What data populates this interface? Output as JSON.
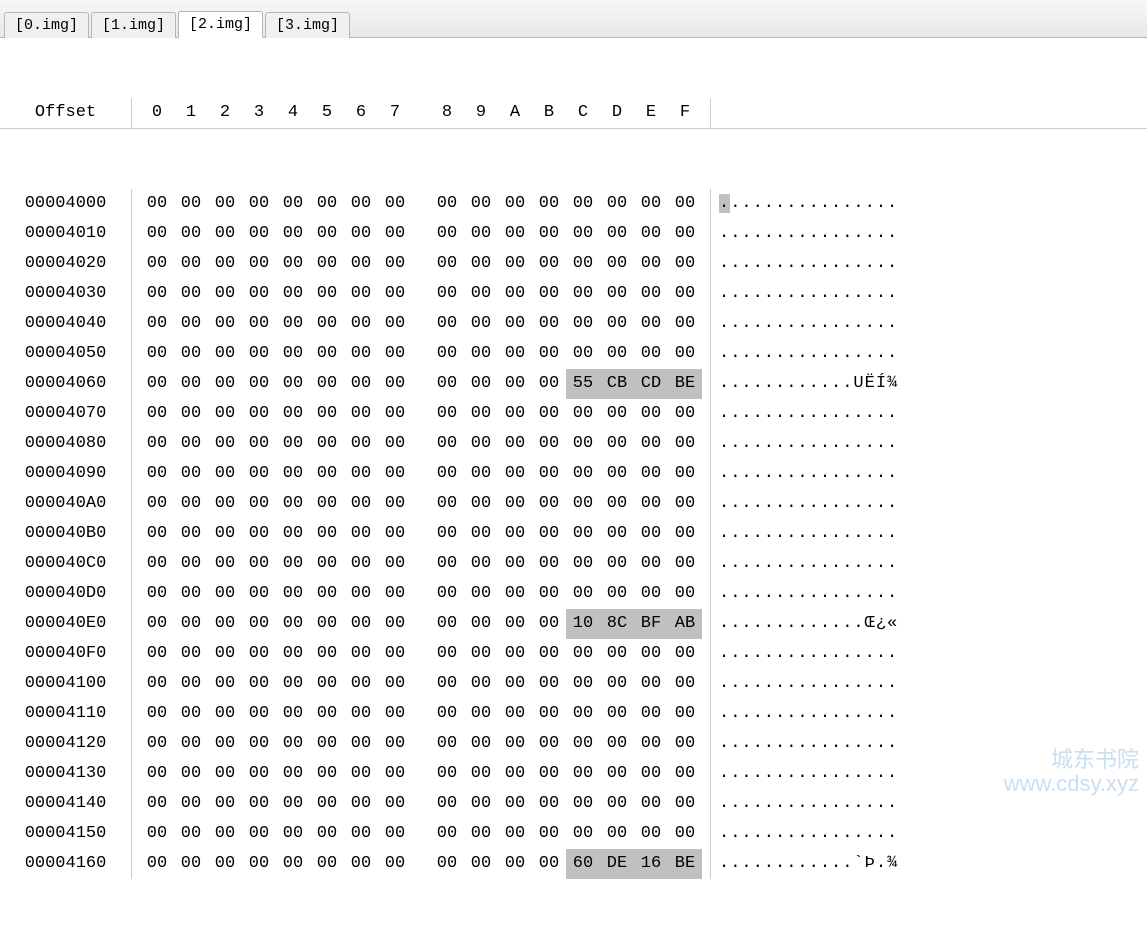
{
  "tabs": [
    {
      "label": "[0.img]",
      "active": false
    },
    {
      "label": "[1.img]",
      "active": false
    },
    {
      "label": "[2.img]",
      "active": true
    },
    {
      "label": "[3.img]",
      "active": false
    }
  ],
  "header": {
    "offset_label": "Offset",
    "columns": [
      "0",
      "1",
      "2",
      "3",
      "4",
      "5",
      "6",
      "7",
      "8",
      "9",
      "A",
      "B",
      "C",
      "D",
      "E",
      "F"
    ]
  },
  "rows": [
    {
      "offset": "00004000",
      "bytes": [
        "00",
        "00",
        "00",
        "00",
        "00",
        "00",
        "00",
        "00",
        "00",
        "00",
        "00",
        "00",
        "00",
        "00",
        "00",
        "00"
      ],
      "hl": [],
      "ascii": "................",
      "ascii_sel0": true
    },
    {
      "offset": "00004010",
      "bytes": [
        "00",
        "00",
        "00",
        "00",
        "00",
        "00",
        "00",
        "00",
        "00",
        "00",
        "00",
        "00",
        "00",
        "00",
        "00",
        "00"
      ],
      "hl": [],
      "ascii": "................"
    },
    {
      "offset": "00004020",
      "bytes": [
        "00",
        "00",
        "00",
        "00",
        "00",
        "00",
        "00",
        "00",
        "00",
        "00",
        "00",
        "00",
        "00",
        "00",
        "00",
        "00"
      ],
      "hl": [],
      "ascii": "................"
    },
    {
      "offset": "00004030",
      "bytes": [
        "00",
        "00",
        "00",
        "00",
        "00",
        "00",
        "00",
        "00",
        "00",
        "00",
        "00",
        "00",
        "00",
        "00",
        "00",
        "00"
      ],
      "hl": [],
      "ascii": "................"
    },
    {
      "offset": "00004040",
      "bytes": [
        "00",
        "00",
        "00",
        "00",
        "00",
        "00",
        "00",
        "00",
        "00",
        "00",
        "00",
        "00",
        "00",
        "00",
        "00",
        "00"
      ],
      "hl": [],
      "ascii": "................"
    },
    {
      "offset": "00004050",
      "bytes": [
        "00",
        "00",
        "00",
        "00",
        "00",
        "00",
        "00",
        "00",
        "00",
        "00",
        "00",
        "00",
        "00",
        "00",
        "00",
        "00"
      ],
      "hl": [],
      "ascii": "................"
    },
    {
      "offset": "00004060",
      "bytes": [
        "00",
        "00",
        "00",
        "00",
        "00",
        "00",
        "00",
        "00",
        "00",
        "00",
        "00",
        "00",
        "55",
        "CB",
        "CD",
        "BE"
      ],
      "hl": [
        12,
        13,
        14,
        15
      ],
      "ascii": "............UËÍ¾"
    },
    {
      "offset": "00004070",
      "bytes": [
        "00",
        "00",
        "00",
        "00",
        "00",
        "00",
        "00",
        "00",
        "00",
        "00",
        "00",
        "00",
        "00",
        "00",
        "00",
        "00"
      ],
      "hl": [],
      "ascii": "................"
    },
    {
      "offset": "00004080",
      "bytes": [
        "00",
        "00",
        "00",
        "00",
        "00",
        "00",
        "00",
        "00",
        "00",
        "00",
        "00",
        "00",
        "00",
        "00",
        "00",
        "00"
      ],
      "hl": [],
      "ascii": "................"
    },
    {
      "offset": "00004090",
      "bytes": [
        "00",
        "00",
        "00",
        "00",
        "00",
        "00",
        "00",
        "00",
        "00",
        "00",
        "00",
        "00",
        "00",
        "00",
        "00",
        "00"
      ],
      "hl": [],
      "ascii": "................"
    },
    {
      "offset": "000040A0",
      "bytes": [
        "00",
        "00",
        "00",
        "00",
        "00",
        "00",
        "00",
        "00",
        "00",
        "00",
        "00",
        "00",
        "00",
        "00",
        "00",
        "00"
      ],
      "hl": [],
      "ascii": "................"
    },
    {
      "offset": "000040B0",
      "bytes": [
        "00",
        "00",
        "00",
        "00",
        "00",
        "00",
        "00",
        "00",
        "00",
        "00",
        "00",
        "00",
        "00",
        "00",
        "00",
        "00"
      ],
      "hl": [],
      "ascii": "................"
    },
    {
      "offset": "000040C0",
      "bytes": [
        "00",
        "00",
        "00",
        "00",
        "00",
        "00",
        "00",
        "00",
        "00",
        "00",
        "00",
        "00",
        "00",
        "00",
        "00",
        "00"
      ],
      "hl": [],
      "ascii": "................"
    },
    {
      "offset": "000040D0",
      "bytes": [
        "00",
        "00",
        "00",
        "00",
        "00",
        "00",
        "00",
        "00",
        "00",
        "00",
        "00",
        "00",
        "00",
        "00",
        "00",
        "00"
      ],
      "hl": [],
      "ascii": "................"
    },
    {
      "offset": "000040E0",
      "bytes": [
        "00",
        "00",
        "00",
        "00",
        "00",
        "00",
        "00",
        "00",
        "00",
        "00",
        "00",
        "00",
        "10",
        "8C",
        "BF",
        "AB"
      ],
      "hl": [
        12,
        13,
        14,
        15
      ],
      "ascii": ".............Œ¿«"
    },
    {
      "offset": "000040F0",
      "bytes": [
        "00",
        "00",
        "00",
        "00",
        "00",
        "00",
        "00",
        "00",
        "00",
        "00",
        "00",
        "00",
        "00",
        "00",
        "00",
        "00"
      ],
      "hl": [],
      "ascii": "................"
    },
    {
      "offset": "00004100",
      "bytes": [
        "00",
        "00",
        "00",
        "00",
        "00",
        "00",
        "00",
        "00",
        "00",
        "00",
        "00",
        "00",
        "00",
        "00",
        "00",
        "00"
      ],
      "hl": [],
      "ascii": "................"
    },
    {
      "offset": "00004110",
      "bytes": [
        "00",
        "00",
        "00",
        "00",
        "00",
        "00",
        "00",
        "00",
        "00",
        "00",
        "00",
        "00",
        "00",
        "00",
        "00",
        "00"
      ],
      "hl": [],
      "ascii": "................"
    },
    {
      "offset": "00004120",
      "bytes": [
        "00",
        "00",
        "00",
        "00",
        "00",
        "00",
        "00",
        "00",
        "00",
        "00",
        "00",
        "00",
        "00",
        "00",
        "00",
        "00"
      ],
      "hl": [],
      "ascii": "................"
    },
    {
      "offset": "00004130",
      "bytes": [
        "00",
        "00",
        "00",
        "00",
        "00",
        "00",
        "00",
        "00",
        "00",
        "00",
        "00",
        "00",
        "00",
        "00",
        "00",
        "00"
      ],
      "hl": [],
      "ascii": "................"
    },
    {
      "offset": "00004140",
      "bytes": [
        "00",
        "00",
        "00",
        "00",
        "00",
        "00",
        "00",
        "00",
        "00",
        "00",
        "00",
        "00",
        "00",
        "00",
        "00",
        "00"
      ],
      "hl": [],
      "ascii": "................"
    },
    {
      "offset": "00004150",
      "bytes": [
        "00",
        "00",
        "00",
        "00",
        "00",
        "00",
        "00",
        "00",
        "00",
        "00",
        "00",
        "00",
        "00",
        "00",
        "00",
        "00"
      ],
      "hl": [],
      "ascii": "................"
    },
    {
      "offset": "00004160",
      "bytes": [
        "00",
        "00",
        "00",
        "00",
        "00",
        "00",
        "00",
        "00",
        "00",
        "00",
        "00",
        "00",
        "60",
        "DE",
        "16",
        "BE"
      ],
      "hl": [
        12,
        13,
        14,
        15
      ],
      "ascii": "............`Þ.¾"
    }
  ],
  "watermark": {
    "line1": "城东书院",
    "line2": "www.cdsy.xyz"
  }
}
